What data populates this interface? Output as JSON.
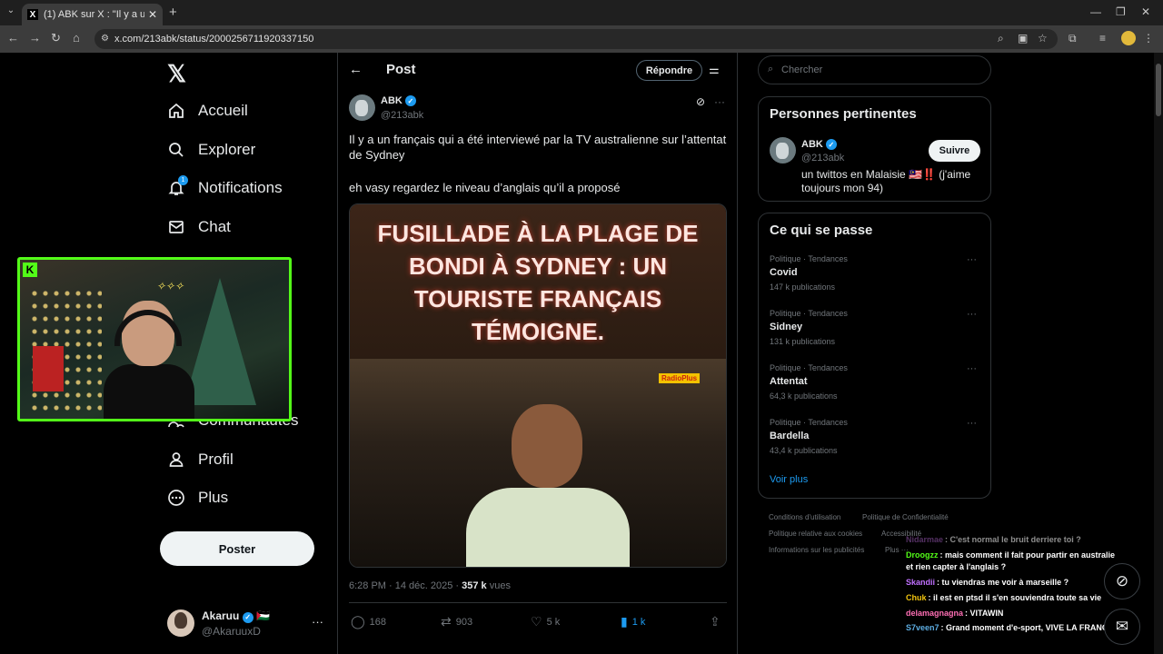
{
  "browser": {
    "tab_title": "(1) ABK sur X : \"Il y a un fra...",
    "url": "x.com/213abk/status/2000256711920337150"
  },
  "nav": {
    "items": [
      {
        "label": "Accueil",
        "icon": "home-icon"
      },
      {
        "label": "Explorer",
        "icon": "search-icon"
      },
      {
        "label": "Notifications",
        "icon": "bell-icon",
        "badge": "1"
      },
      {
        "label": "Chat",
        "icon": "mail-icon"
      },
      {
        "label": "Communautés",
        "icon": "people-icon"
      },
      {
        "label": "Profil",
        "icon": "person-icon"
      },
      {
        "label": "Plus",
        "icon": "more-circle-icon"
      }
    ],
    "post_button": "Poster"
  },
  "account": {
    "name": "Akaruu",
    "handle": "@AkaruuxD"
  },
  "post": {
    "header_title": "Post",
    "reply_button": "Répondre",
    "author_name": "ABK",
    "author_handle": "@213abk",
    "text1": "Il y a un français qui a été interviewé par la TV australienne sur l’attentat de Sydney",
    "text2": "eh vasy regardez le niveau d’anglais qu’il a proposé",
    "media_caption_lines": [
      "FUSILLADE À LA PLAGE DE",
      "BONDI À SYDNEY : UN",
      "TOURISTE FRANÇAIS",
      "TÉMOIGNE."
    ],
    "media_watermark": "RadioPlus",
    "timestamp": "6:28 PM · 14 déc. 2025 · ",
    "views_count": "357 k",
    "views_label": " vues",
    "replies": "168",
    "reposts": "903",
    "likes": "5 k",
    "bookmarks": "1 k"
  },
  "sidebar": {
    "search_placeholder": "Chercher",
    "relevant_title": "Personnes pertinentes",
    "relevant_person": {
      "name": "ABK",
      "handle": "@213abk",
      "bio": "un twittos en Malaisie 🇲🇾‼️ (j'aime toujours mon 94)",
      "follow_label": "Suivre"
    },
    "trends_title": "Ce qui se passe",
    "trends": [
      {
        "category": "Politique · Tendances",
        "name": "Covid",
        "count": "147 k publications"
      },
      {
        "category": "Politique · Tendances",
        "name": "Sidney",
        "count": "131 k publications"
      },
      {
        "category": "Politique · Tendances",
        "name": "Attentat",
        "count": "64,3 k publications"
      },
      {
        "category": "Politique · Tendances",
        "name": "Bardella",
        "count": "43,4 k publications"
      }
    ],
    "see_more": "Voir plus",
    "footer": [
      "Conditions d'utilisation",
      "Politique de Confidentialité",
      "Politique relative aux cookies",
      "Accessibilité",
      "Informations sur les publicités",
      "Plus ···"
    ]
  },
  "chat": [
    {
      "user": "Nidarmae",
      "color": "#9b59b6",
      "msg": ": C'est normal le bruit derriere toi ?"
    },
    {
      "user": "Droogzz",
      "color": "#53fc18",
      "msg": ": mais comment il fait pour partir en australie"
    },
    {
      "user": "",
      "color": "#ffffff",
      "msg": "et rien capter à l'anglais ?"
    },
    {
      "user": "Skandii",
      "color": "#c070ff",
      "msg": ": tu viendras me voir à marseille ?"
    },
    {
      "user": "Chuk",
      "color": "#f1c40f",
      "msg": ": il est en ptsd il s'en souviendra toute sa vie"
    },
    {
      "user": "delamagnagna",
      "color": "#ff6fb5",
      "msg": ": VITAWIN"
    },
    {
      "user": "S7veen7",
      "color": "#5dade2",
      "msg": ": Grand moment d'e-sport, VIVE LA FRANCE"
    }
  ]
}
